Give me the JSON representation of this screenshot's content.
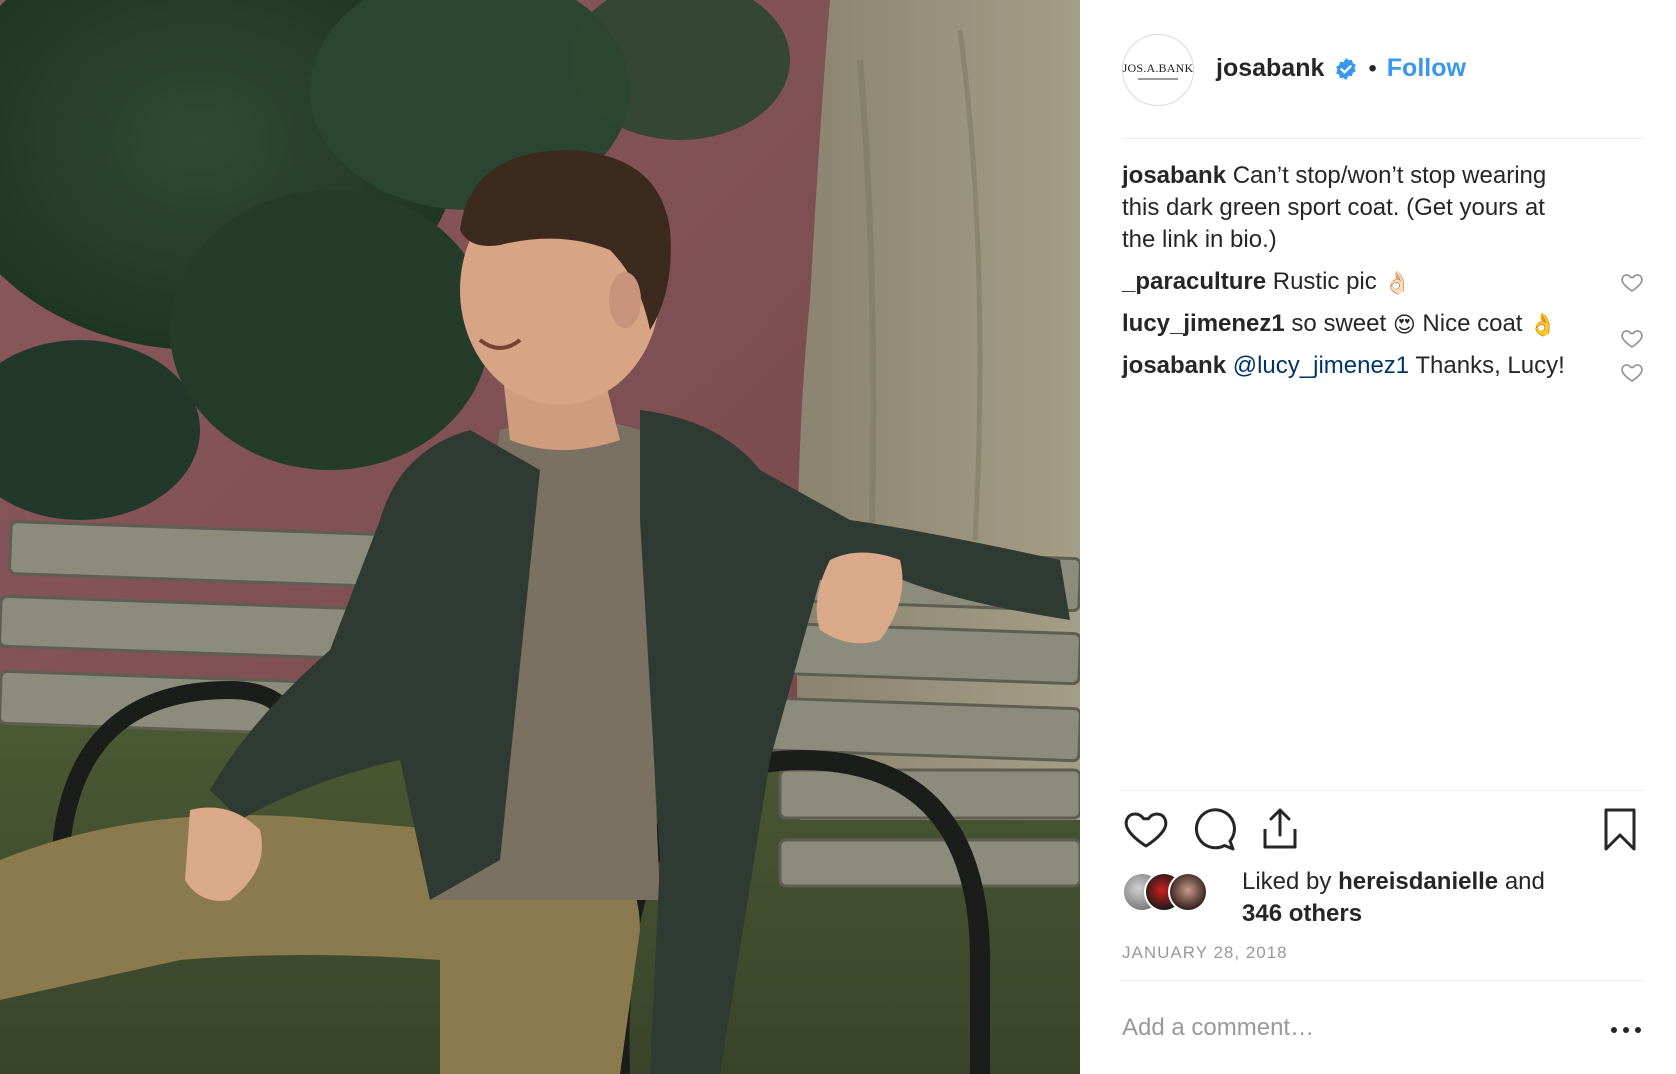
{
  "post": {
    "username": "josabank",
    "separator": "•",
    "follow_label": "Follow",
    "avatar_text": "JOS.A.BANK",
    "verified_icon": "verified-badge-icon",
    "accent_color": "#3897f0"
  },
  "comments": [
    {
      "author": "josabank",
      "text": "Can’t stop/won’t stop wearing this dark green sport coat. (Get yours at the link in bio.)",
      "likeable": false
    },
    {
      "author": "_paraculture",
      "text": "Rustic pic",
      "emoji": "👌🏻",
      "likeable": true
    },
    {
      "author": "lucy_jimenez1",
      "text": "so sweet",
      "emoji": "😍",
      "text2": "Nice coat",
      "emoji2": "👌",
      "likeable": true
    },
    {
      "author": "josabank",
      "mention": "@lucy_jimenez1",
      "text": "Thanks, Lucy!",
      "likeable": true
    }
  ],
  "actions": {
    "like_icon": "heart-icon",
    "comment_icon": "comment-icon",
    "share_icon": "share-icon",
    "save_icon": "bookmark-icon"
  },
  "likes": {
    "prefix": "Liked by",
    "user": "hereisdanielle",
    "conj": "and",
    "others": "346 others"
  },
  "date": "JANUARY 28, 2018",
  "add_comment_placeholder": "Add a comment…",
  "more_icon": "more-options-icon"
}
